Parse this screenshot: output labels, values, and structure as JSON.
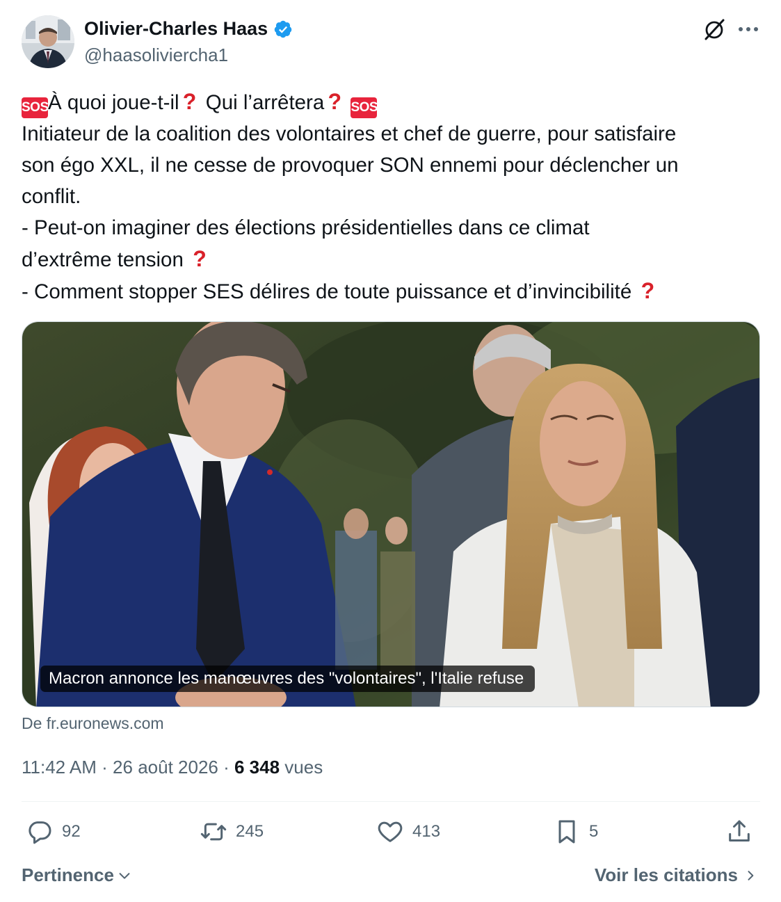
{
  "author": {
    "name": "Olivier-Charles Haas",
    "handle": "@haasoliviercha1",
    "verified": true,
    "verified_color": "#1d9bf0"
  },
  "tweet": {
    "lines": {
      "l1_a": "À quoi joue-t-il",
      "l1_b": " Qui l’arrêtera",
      "l2": "Initiateur de la coalition des volontaires et chef de guerre, pour satisfaire",
      "l3": "son égo XXL, il ne cesse de provoquer SON ennemi pour déclencher un",
      "l4": "conflit.",
      "l5": "- Peut-on imaginer des élections présidentielles dans ce climat",
      "l6": "d’extrême tension ",
      "l7": "- Comment stopper SES délires de toute puissance et d’invincibilité "
    },
    "emoji_sos_label": "SOS",
    "emoji_question": "?",
    "emoji_sos_color": "#e8243c",
    "emoji_question_color": "#d9212a"
  },
  "card": {
    "caption": "Macron annonce les manœuvres des \"volontaires\", l'Italie refuse",
    "source": "De fr.euronews.com"
  },
  "meta": {
    "time": "11:42 AM",
    "sep1": " · ",
    "date": "26 août 2026",
    "sep2": " · ",
    "views_count": "6 348",
    "views_label": " vues"
  },
  "actions": {
    "replies": "92",
    "reposts": "245",
    "likes": "413",
    "bookmarks": "5"
  },
  "footer": {
    "sort_label": "Pertinence",
    "quotes_label": "Voir les citations"
  },
  "icons": {
    "verified": "verified-badge-icon",
    "grok": "grok-icon",
    "more": "more-icon",
    "reply": "reply-icon",
    "repost": "repost-icon",
    "like": "heart-icon",
    "bookmark": "bookmark-icon",
    "share": "share-icon"
  },
  "colors": {
    "text_primary": "#0f1419",
    "text_secondary": "#536471",
    "divider": "#eff3f4"
  }
}
